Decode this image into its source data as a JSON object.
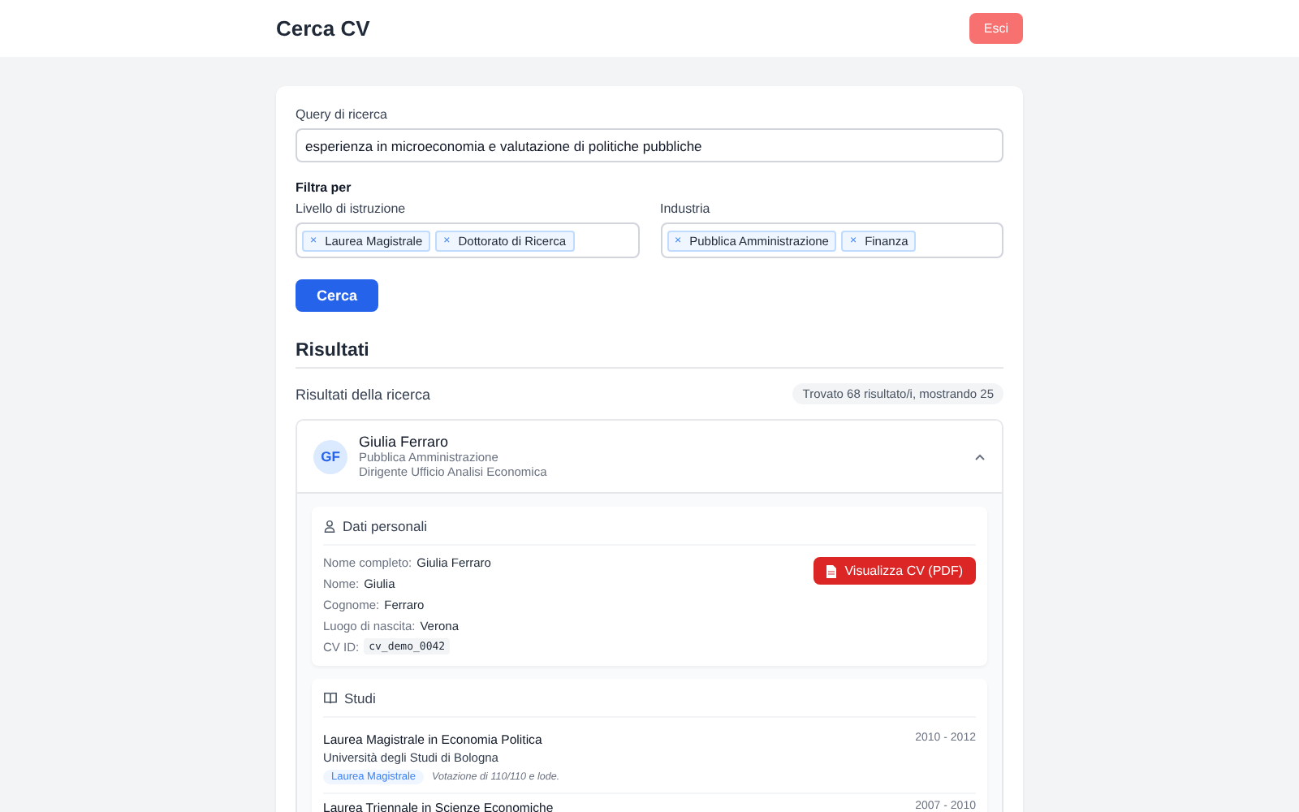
{
  "header": {
    "title": "Cerca CV",
    "logout": "Esci"
  },
  "search": {
    "label": "Query di ricerca",
    "value": "esperienza in microeconomia e valutazione di politiche pubbliche"
  },
  "filters": {
    "title": "Filtra per",
    "groups": [
      {
        "label": "Livello di istruzione",
        "tags": [
          {
            "remove": "×",
            "text": "Laurea Magistrale"
          },
          {
            "remove": "×",
            "text": "Dottorato di Ricerca"
          }
        ]
      },
      {
        "label": "Industria",
        "tags": [
          {
            "remove": "×",
            "text": "Pubblica Amministrazione"
          },
          {
            "remove": "×",
            "text": "Finanza"
          }
        ]
      }
    ]
  },
  "search_button": "Cerca",
  "results": {
    "title": "Risultati",
    "subtitle": "Risultati della ricerca",
    "count": "Trovato 68 risultato/i, mostrando 25",
    "items": [
      {
        "initials": "GF",
        "name": "Giulia Ferraro",
        "industry": "Pubblica Amministrazione",
        "role": "Dirigente Ufficio Analisi Economica",
        "expanded": true,
        "personal": {
          "title": "Dati personali",
          "button": "Visualizza CV (PDF)",
          "fields": [
            {
              "label": "Nome completo:",
              "value": "Giulia Ferraro"
            },
            {
              "label": "Nome:",
              "value": "Giulia"
            },
            {
              "label": "Cognome:",
              "value": "Ferraro"
            },
            {
              "label": "Luogo di nascita:",
              "value": "Verona"
            },
            {
              "label": "CV ID:",
              "value": "cv_demo_0042",
              "kind": "code"
            }
          ]
        },
        "studies": {
          "title": "Studi",
          "entries": [
            {
              "degree": "Laurea Magistrale in Economia Politica",
              "school": "Università degli Studi di Bologna",
              "years": "2010 - 2012",
              "badge": "Laurea Magistrale",
              "note": "Votazione di 110/110 e lode."
            },
            {
              "degree": "Laurea Triennale in Scienze Economiche",
              "years": "2007 - 2010"
            }
          ]
        }
      }
    ]
  }
}
